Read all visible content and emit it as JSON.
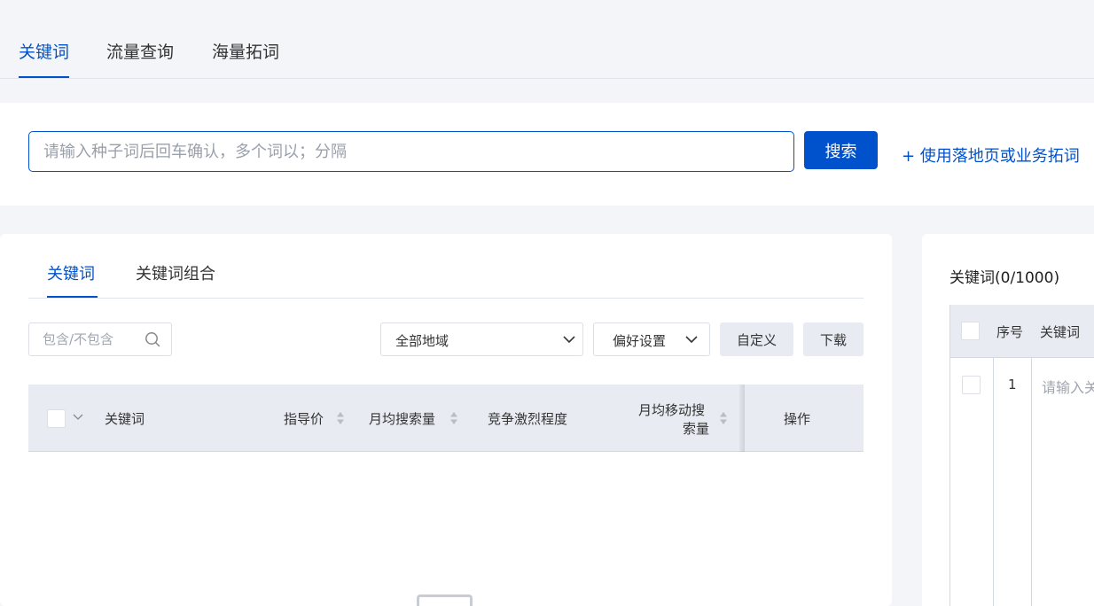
{
  "top_tabs": [
    {
      "label": "关键词",
      "active": true
    },
    {
      "label": "流量查询",
      "active": false
    },
    {
      "label": "海量拓词",
      "active": false
    }
  ],
  "search": {
    "placeholder": "请输入种子词后回车确认，多个词以；分隔",
    "value": "",
    "button_label": "搜索",
    "landing_link": "+ 使用落地页或业务拓词"
  },
  "sub_tabs": [
    {
      "label": "关键词",
      "active": true
    },
    {
      "label": "关键词组合",
      "active": false
    }
  ],
  "filters": {
    "include_placeholder": "包含/不包含",
    "region_value": "全部地域",
    "preference_label": "偏好设置",
    "customize_label": "自定义",
    "download_label": "下载"
  },
  "table": {
    "columns": {
      "keyword": "关键词",
      "guide_price": "指导价",
      "monthly_search": "月均搜索量",
      "competition": "竞争激烈程度",
      "monthly_mobile_search_line1": "月均移动搜",
      "monthly_mobile_search_line2": "索量",
      "operation": "操作"
    },
    "rows": []
  },
  "selected_panel": {
    "title": "关键词(0/1000)",
    "columns": {
      "index": "序号",
      "keyword": "关键词"
    },
    "rows": [
      {
        "index": "1",
        "keyword_placeholder": "请输入关"
      }
    ]
  },
  "colors": {
    "accent": "#0052cc",
    "page_bg": "#f4f5f9",
    "table_header_bg": "#e8ebf2"
  }
}
